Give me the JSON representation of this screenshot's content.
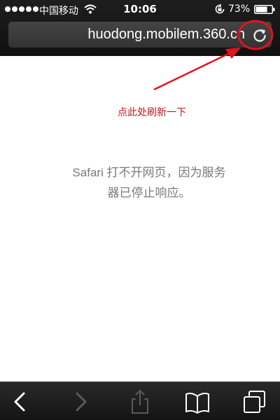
{
  "status_bar": {
    "carrier": "中国移动",
    "time": "10:06",
    "battery_percent": "73%",
    "battery_level": 0.73,
    "signal_dots": 5,
    "icons": [
      "signal-dots-icon",
      "wifi-icon",
      "rotation-lock-icon",
      "battery-icon"
    ]
  },
  "address_bar": {
    "url": "huodong.mobilem.360.cn",
    "reload_icon": "reload-icon"
  },
  "annotation": {
    "text": "点此处刷新一下",
    "color": "#c8141a"
  },
  "main": {
    "error_line_1": "Safari 打不开网页，因为服务",
    "error_line_2": "器已停止响应。"
  },
  "toolbar": {
    "items": [
      "back-icon",
      "forward-icon",
      "share-icon",
      "bookmarks-icon",
      "tabs-icon"
    ]
  },
  "colors": {
    "bar_background": "#1a1a1a",
    "error_text": "#7a7a7a",
    "annotation": "#c8141a"
  }
}
